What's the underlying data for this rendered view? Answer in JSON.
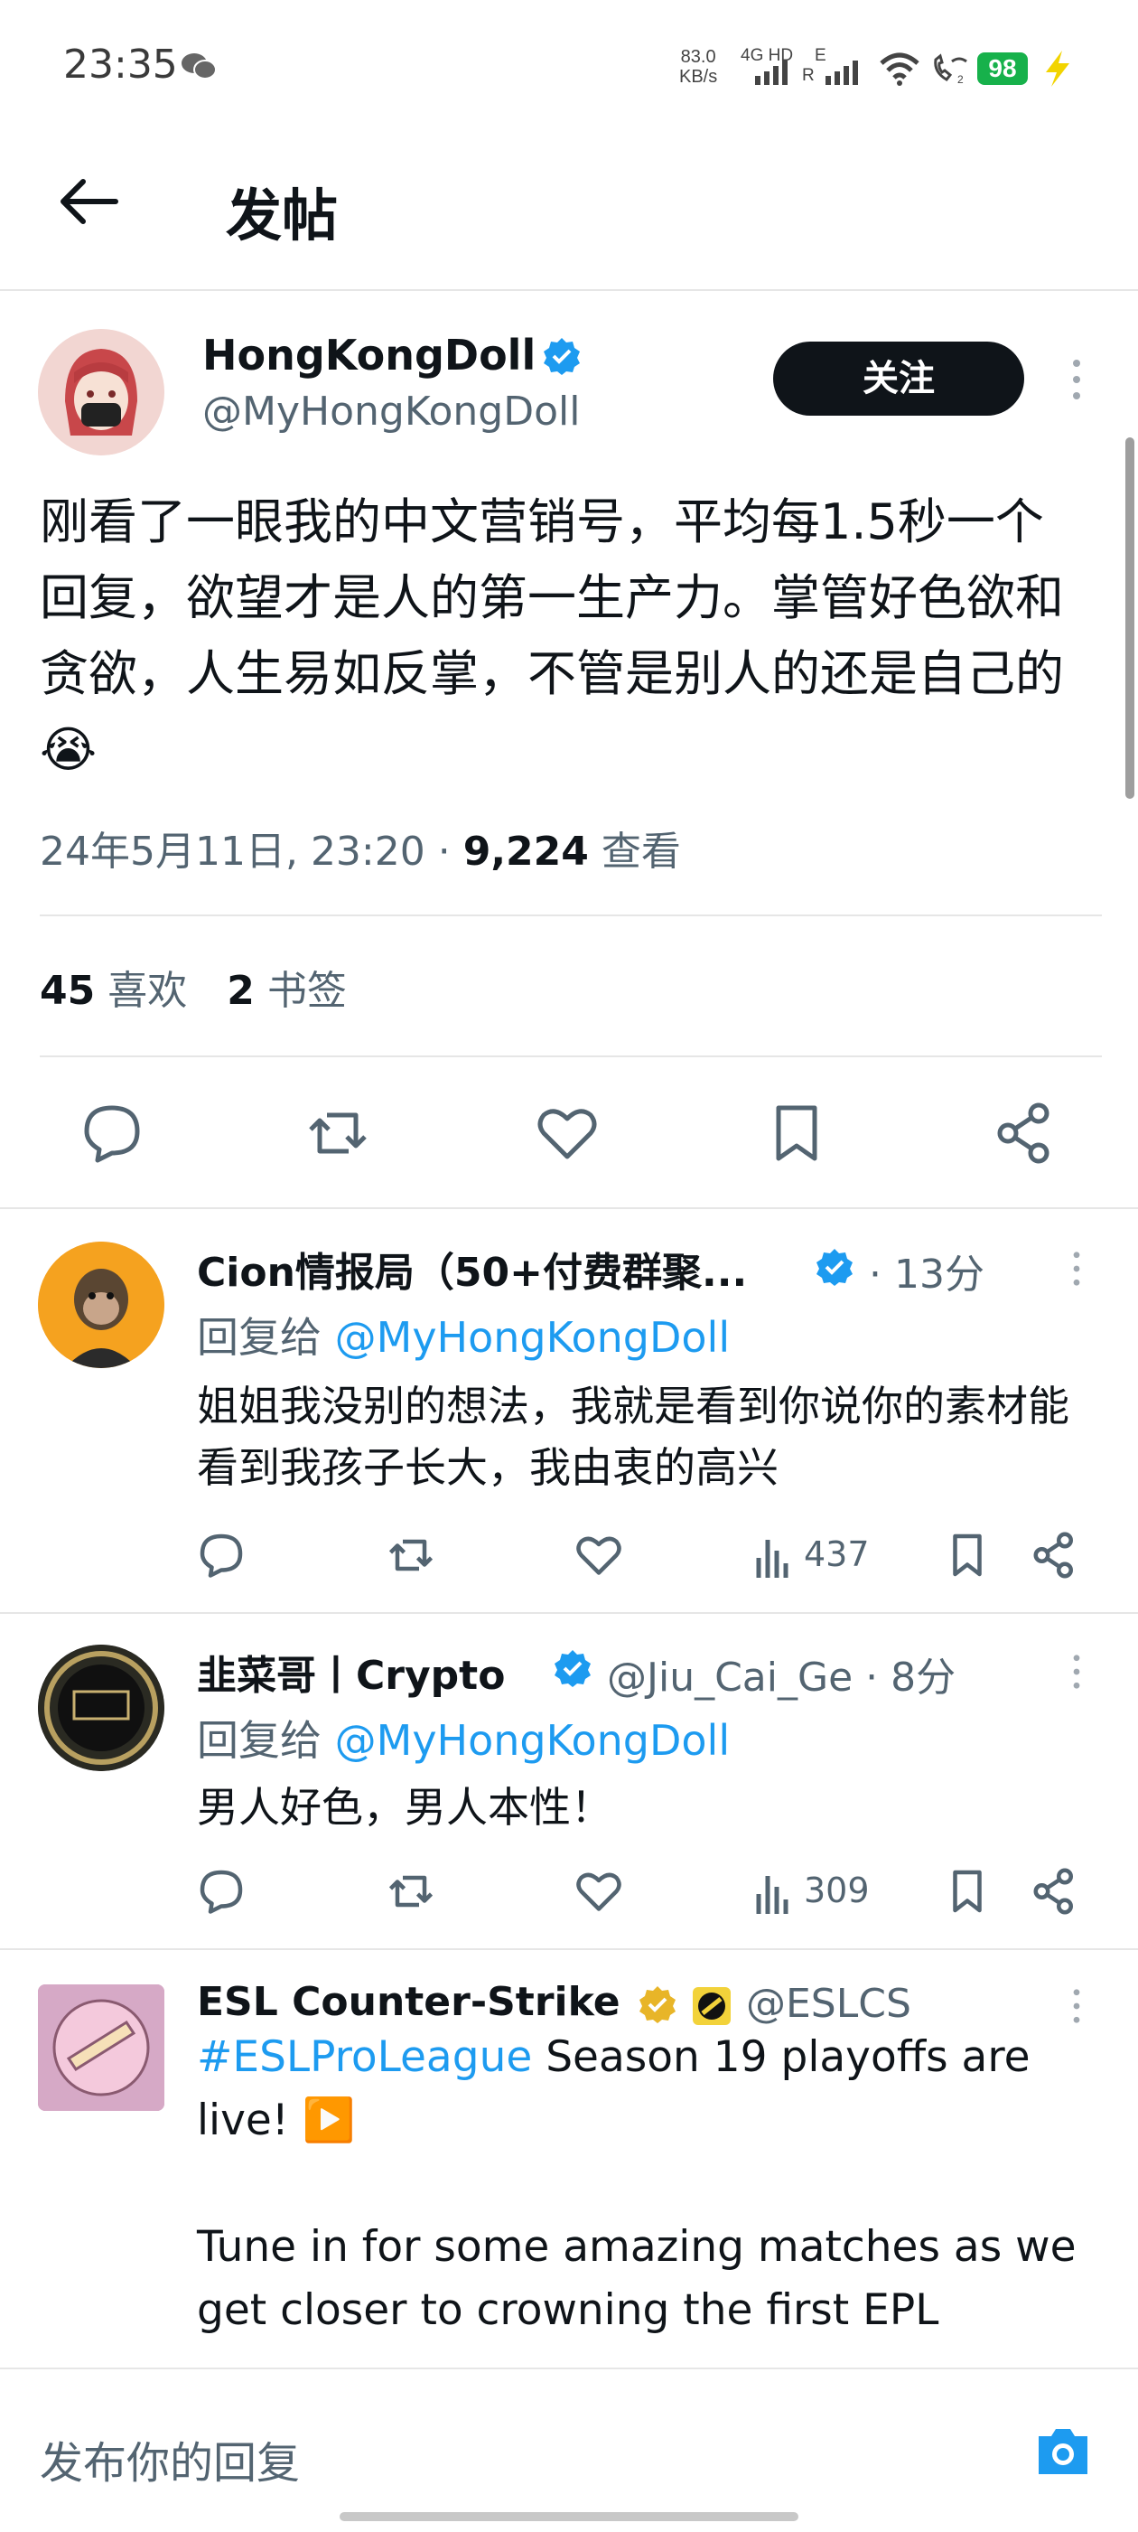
{
  "status_bar": {
    "time": "23:35",
    "net_speed_value": "83.0",
    "net_speed_unit": "KB/s",
    "sig1_label_top": "4G HD",
    "sig2_label_top": "E",
    "sig2_label_bottom": "R",
    "battery": "98"
  },
  "header": {
    "title": "发帖"
  },
  "tweet": {
    "author_name": "HongKongDoll",
    "handle": "@MyHongKongDoll",
    "follow_label": "关注",
    "text": "刚看了一眼我的中文营销号，平均每1.5秒一个回复，欲望才是人的第一生产力。掌管好色欲和贪欲，人生易如反掌，不管是别人的还是自己的😭",
    "datetime": "24年5月11日, 23:20 · ",
    "views_count": "9,224",
    "views_label": " 查看",
    "likes_count": "45",
    "likes_label": " 喜欢",
    "bookmarks_count": "2",
    "bookmarks_label": " 书签"
  },
  "replies": [
    {
      "name": "Cion情报局（50+付费群聚...",
      "time": "· 13分",
      "reply_to_prefix": "回复给 ",
      "reply_to_handle": "@MyHongKongDoll",
      "text": "姐姐我没别的想法，我就是看到你说你的素材能看到我孩子长大，我由衷的高兴",
      "views": "437"
    },
    {
      "name": "韭菜哥丨Crypto",
      "handle": "@Jiu_Cai_Ge",
      "time": "· 8分",
      "reply_to_prefix": "回复给 ",
      "reply_to_handle": "@MyHongKongDoll",
      "text": "男人好色，男人本性！",
      "views": "309"
    }
  ],
  "promo": {
    "name": "ESL Counter-Strike",
    "handle": "@ESLCS",
    "hashtag": "#ESLProLeague",
    "line1_rest": " Season 19 playoffs are live! ▶️",
    "line2": "Tune in for some amazing matches as we get closer to crowning the first EPL"
  },
  "composer": {
    "placeholder": "发布你的回复"
  },
  "colors": {
    "accent": "#1d9bf0",
    "text": "#0f1419",
    "secondary": "#536471",
    "gold": "#e8b528"
  }
}
